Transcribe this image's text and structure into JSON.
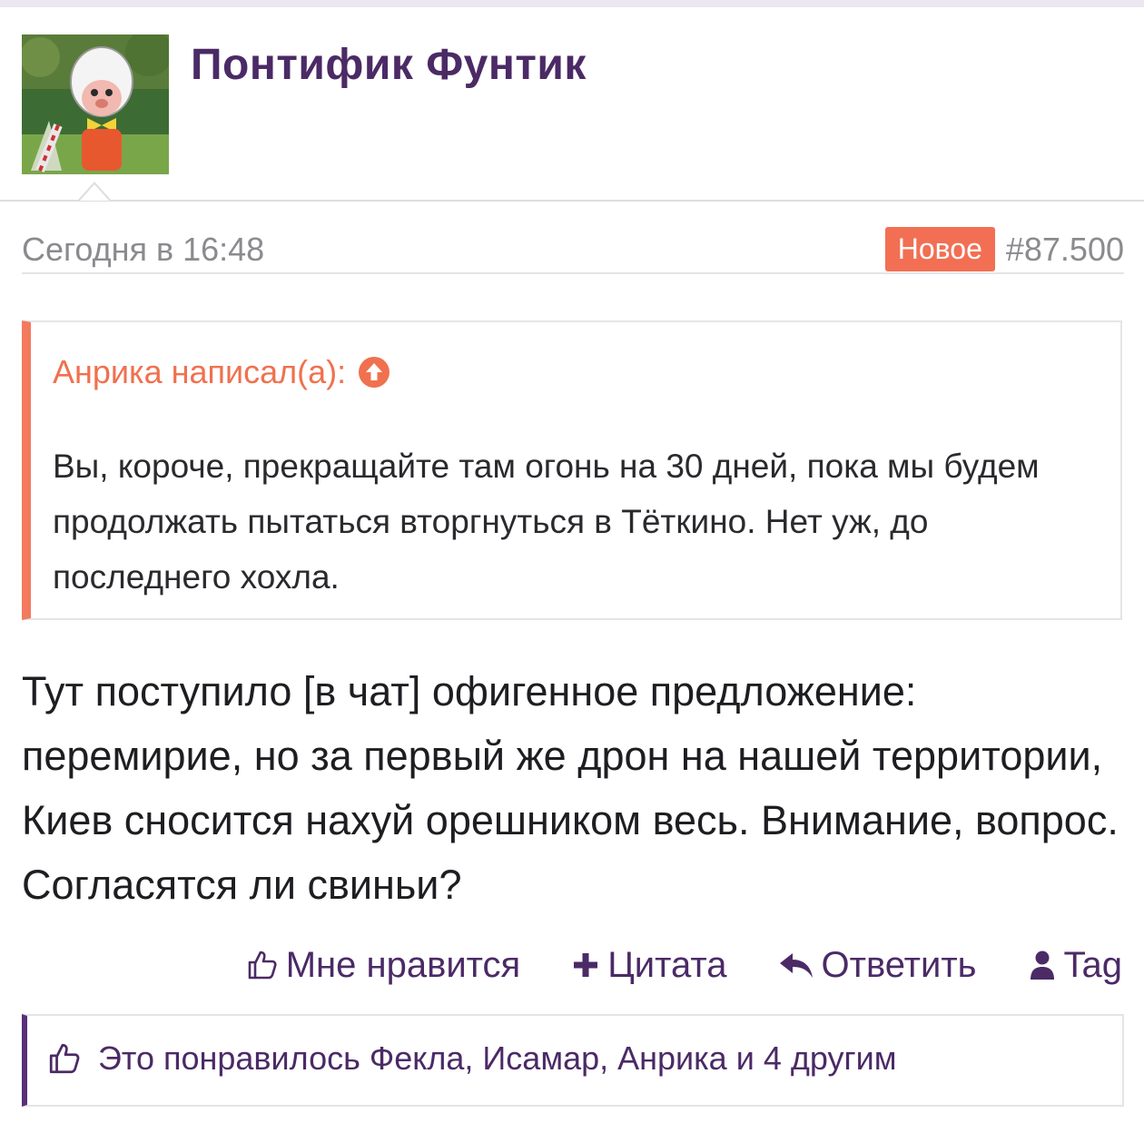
{
  "post": {
    "author": "Понтифик Фунтик",
    "date": "Сегодня в 16:48",
    "badge": "Новое",
    "number": "#87.500"
  },
  "quote": {
    "author_label": "Анрика написал(а):",
    "icon": "arrow-up-circle-icon",
    "text": "Вы, короче, прекращайте там огонь на 30 дней, пока мы будем продолжать пытаться вторгнуться в Тёткино. Нет уж, до последнего хохла."
  },
  "body": {
    "text": "Тут поступило [в чат] офигенное предложение: перемирие, но за первый же дрон на нашей территории, Киев сносится нахуй орешником весь. Внимание, вопрос. Согласятся ли свиньи?"
  },
  "actions": [
    {
      "label": "Мне нравится",
      "icon": "thumbs-up-icon"
    },
    {
      "label": "Цитата",
      "icon": "plus-icon"
    },
    {
      "label": "Ответить",
      "icon": "reply-icon"
    },
    {
      "label": "Tag",
      "icon": "user-icon"
    }
  ],
  "likes": {
    "text": "Это понравилось Фекла, Исамар, Анрика и 4 другим",
    "icon": "thumbs-up-icon"
  },
  "colors": {
    "accent_purple": "#4b2a66",
    "accent_orange": "#f26f53"
  }
}
